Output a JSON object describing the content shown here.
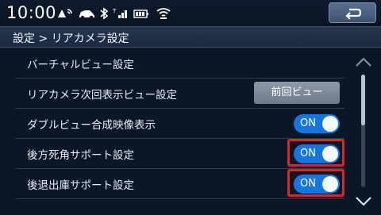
{
  "status": {
    "time": "10:00",
    "icons": [
      "gps-signal-icon",
      "car-icon",
      "bluetooth-icon",
      "cell-signal-icon",
      "battery-icon",
      "wifi-icon"
    ]
  },
  "header": {
    "back_icon": "return-arrow-icon"
  },
  "breadcrumb": {
    "text": "設定 > リアカメラ設定"
  },
  "rows": [
    {
      "label": "バーチャルビュー設定"
    },
    {
      "label": "リアカメラ次回表示ビュー設定",
      "value": "前回ビュー"
    },
    {
      "label": "ダブルビュー合成映像表示",
      "toggle": "ON"
    },
    {
      "label": "後方死角サポート設定",
      "toggle": "ON",
      "highlighted": true
    },
    {
      "label": "後退出庫サポート設定",
      "toggle": "ON",
      "highlighted": true
    }
  ],
  "colors": {
    "toggle_on": "#1676e0",
    "highlight": "#e0242c",
    "background": "#0b1626"
  },
  "scroll": {
    "up_icon": "chevron-up-icon",
    "down_icon": "chevron-down-icon"
  }
}
